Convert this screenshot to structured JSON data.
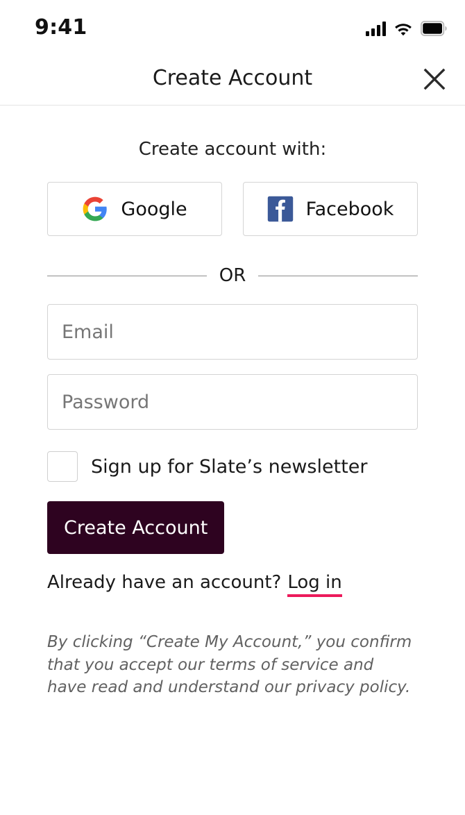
{
  "status_bar": {
    "time": "9:41",
    "signal_icon": "cellular-signal-icon",
    "wifi_icon": "wifi-icon",
    "battery_icon": "battery-full-icon"
  },
  "header": {
    "title": "Create Account",
    "close_icon": "close-x-icon"
  },
  "main": {
    "section_heading": "Create account with:",
    "social": [
      {
        "label": "Google",
        "icon": "google-logo-icon"
      },
      {
        "label": "Facebook",
        "icon": "facebook-logo-icon"
      }
    ],
    "divider_text": "OR",
    "fields": {
      "email_placeholder": "Email",
      "email_value": "",
      "password_placeholder": "Password",
      "password_value": ""
    },
    "newsletter": {
      "label": "Sign up for Slate’s newsletter",
      "checked": false
    },
    "submit_label": "Create Account",
    "login_prompt": "Already have an account?",
    "login_link": "Log in",
    "disclaimer": "By clicking “Create My Account,” you confirm that you accept our terms of service and have read and understand our privacy policy."
  },
  "colors": {
    "primary_button": "#2e0320",
    "link_underline": "#ec1a5b",
    "border": "#d4d4d4",
    "placeholder_text": "#767676",
    "facebook_blue": "#3b5998",
    "google_red": "#ea4335",
    "google_yellow": "#fbbc05",
    "google_green": "#34a853",
    "google_blue": "#4285f4"
  }
}
